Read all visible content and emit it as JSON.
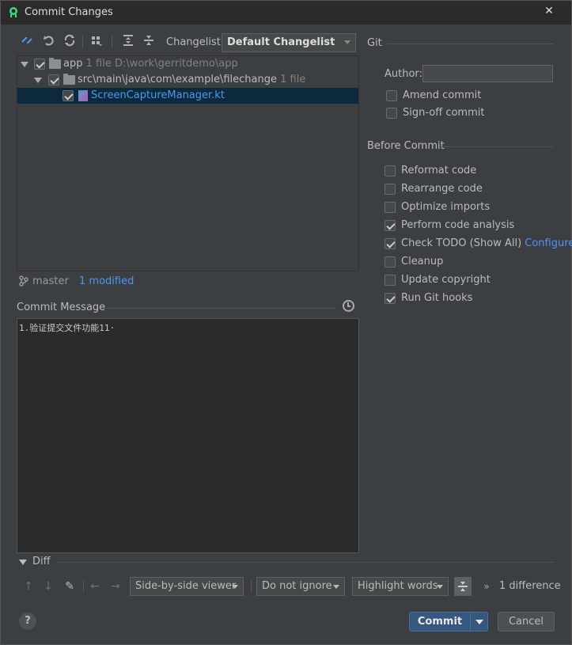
{
  "window": {
    "title": "Commit Changes",
    "close_glyph": "✕"
  },
  "toolbar": {
    "changelist_label": "Changelist:",
    "changelist_value": "Default Changelist",
    "icons": [
      "diff-icon",
      "rollback-icon",
      "refresh-icon",
      "group-by-icon",
      "expand-all-icon",
      "collapse-all-icon"
    ]
  },
  "tree": {
    "rows": [
      {
        "name": "app",
        "meta": "1 file  D:\\work\\gerritdemo\\app"
      },
      {
        "name": "src\\main\\java\\com\\example\\filechange",
        "meta": "1 file"
      },
      {
        "name": "ScreenCaptureManager.kt",
        "meta": ""
      }
    ]
  },
  "branch": {
    "name": "master",
    "modified": "1 modified"
  },
  "commit_message": {
    "label": "Commit Message",
    "text": "1.验证提交文件功能11·"
  },
  "git": {
    "section_label": "Git",
    "author_label": "Author:",
    "author_value": "",
    "options": [
      {
        "label": "Amend commit",
        "checked": false
      },
      {
        "label": "Sign-off commit",
        "checked": false
      }
    ]
  },
  "before_commit": {
    "section_label": "Before Commit",
    "options": [
      {
        "label": "Reformat code",
        "checked": false
      },
      {
        "label": "Rearrange code",
        "checked": false
      },
      {
        "label": "Optimize imports",
        "checked": false
      },
      {
        "label": "Perform code analysis",
        "checked": true
      },
      {
        "label": "Check TODO (Show All)",
        "checked": true
      },
      {
        "label": "Cleanup",
        "checked": false
      },
      {
        "label": "Update copyright",
        "checked": false
      },
      {
        "label": "Run Git hooks",
        "checked": true
      }
    ],
    "configure_link": "Configure"
  },
  "diff": {
    "label": "Diff",
    "viewer": "Side-by-side viewer",
    "ignore": "Do not ignore",
    "highlight": "Highlight words",
    "count": "1 difference"
  },
  "footer": {
    "help": "?",
    "commit": "Commit",
    "cancel": "Cancel"
  },
  "colors": {
    "background": "#3c3f41",
    "selection": "#0d293e",
    "link": "#5394ec",
    "commit_button": "#365880"
  }
}
